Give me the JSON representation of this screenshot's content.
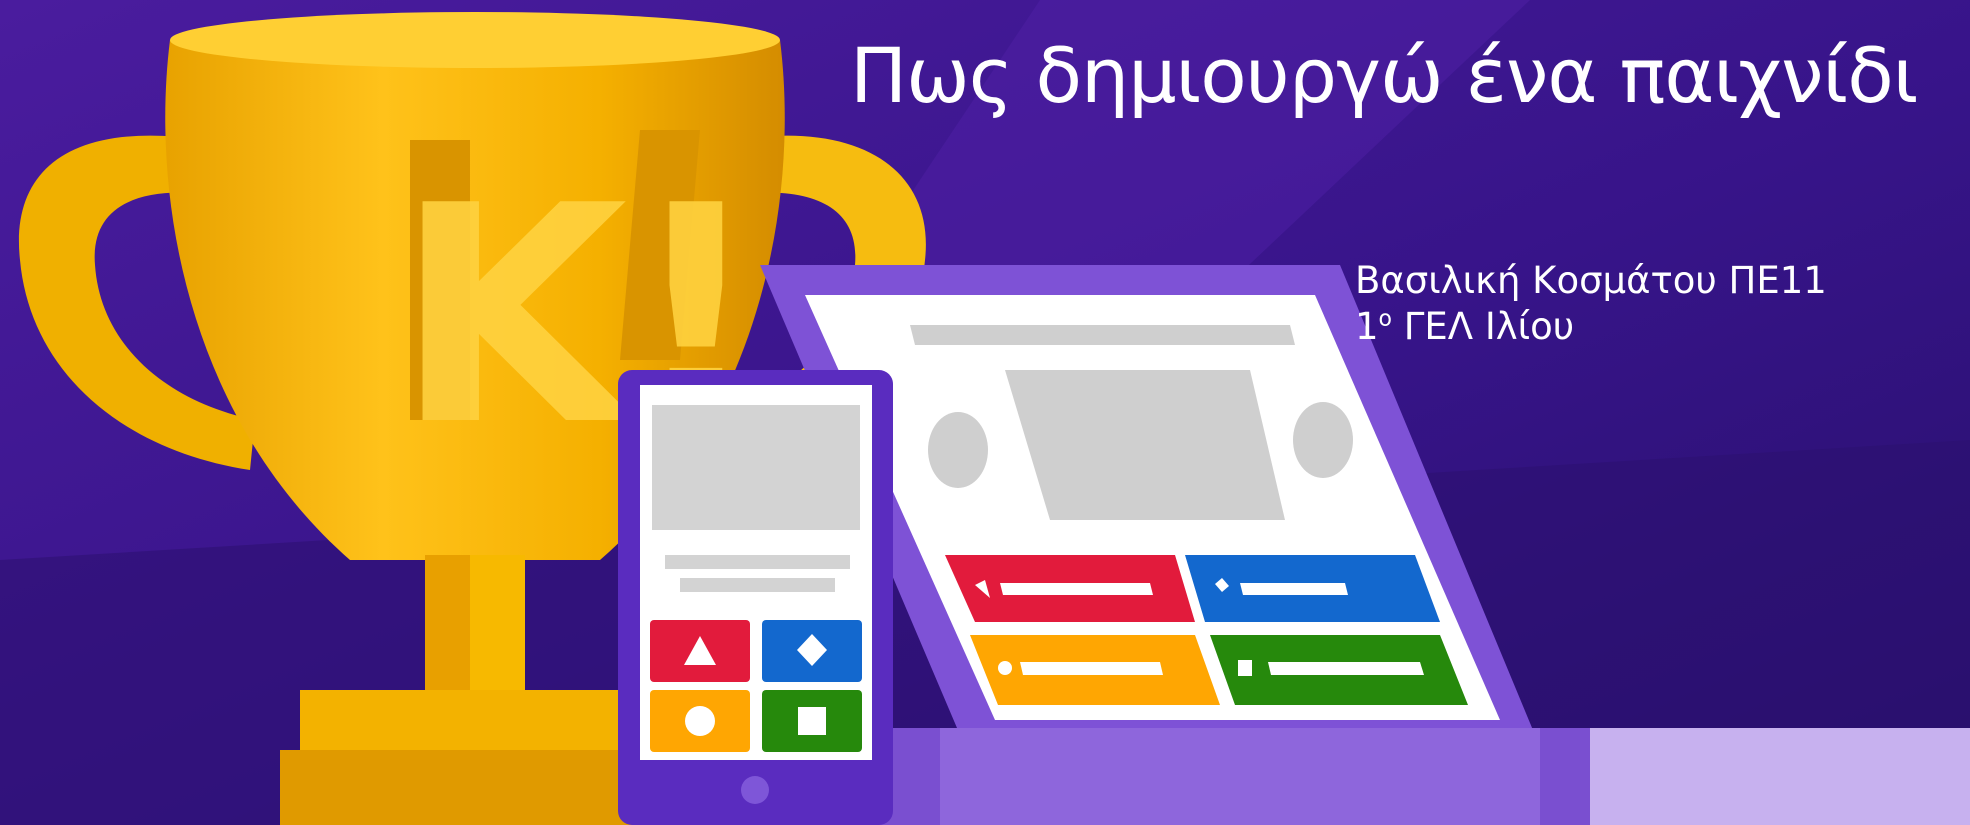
{
  "slide": {
    "title": "Πως δημιουργώ ένα παιχνίδι",
    "author_line": "Βασιλική Κοσμάτου ΠΕ11",
    "school_number": "1",
    "school_superscript": "ο",
    "school_name": " ΓΕΛ Ιλίου",
    "trophy_lettering": "K!"
  },
  "colors": {
    "background_dark": "#2a0f6e",
    "background_light": "#46189a",
    "trophy_gold": "#f5b800",
    "device_purple": "#7a4fd0",
    "answer_red": "#e21b3c",
    "answer_blue": "#1368ce",
    "answer_yellow": "#ffa602",
    "answer_green": "#26890c"
  },
  "icons": [
    "triangle-icon",
    "diamond-icon",
    "circle-icon",
    "square-icon"
  ]
}
